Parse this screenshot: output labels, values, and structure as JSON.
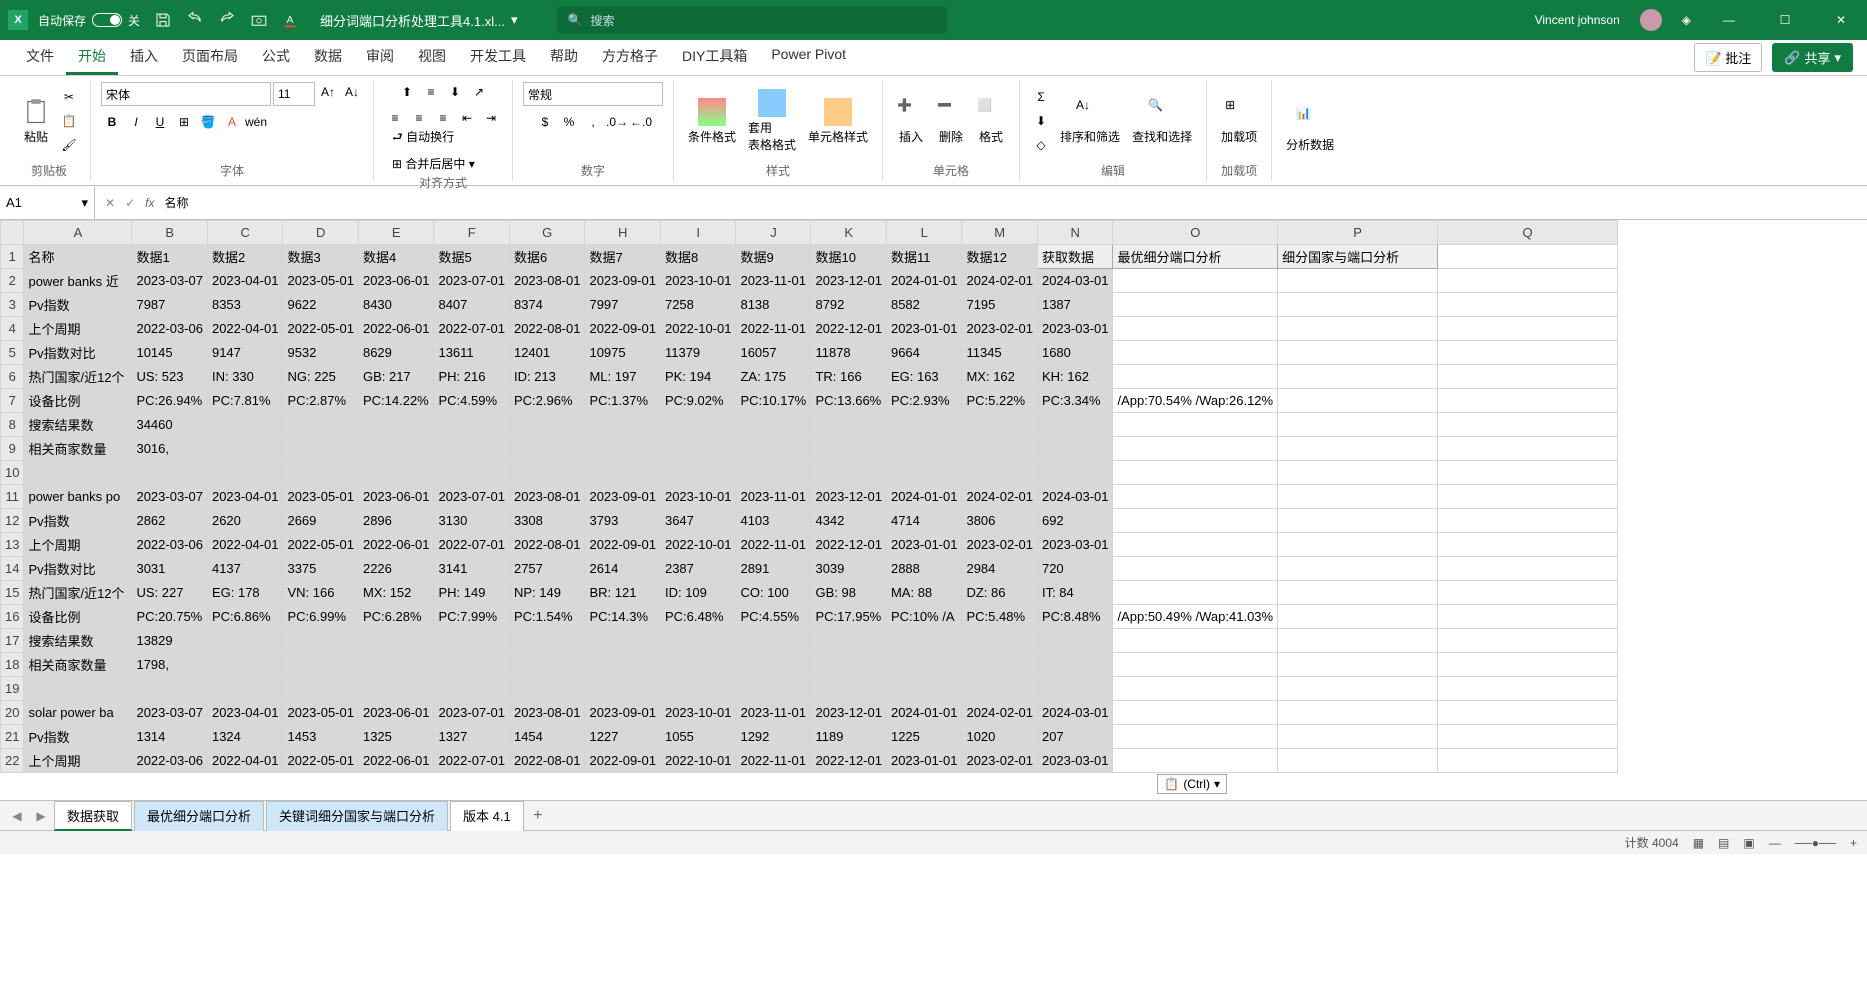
{
  "titlebar": {
    "autosave_label": "自动保存",
    "autosave_state": "关",
    "filename": "细分词端口分析处理工具4.1.xl...",
    "search_placeholder": "搜索",
    "username": "Vincent johnson"
  },
  "ribbon": {
    "tabs": [
      "文件",
      "开始",
      "插入",
      "页面布局",
      "公式",
      "数据",
      "审阅",
      "视图",
      "开发工具",
      "帮助",
      "方方格子",
      "DIY工具箱",
      "Power Pivot"
    ],
    "active_tab": "开始",
    "comment_btn": "批注",
    "share_btn": "共享",
    "groups": {
      "clipboard": {
        "paste": "粘贴",
        "label": "剪贴板"
      },
      "font": {
        "name": "宋体",
        "size": "11",
        "label": "字体"
      },
      "align": {
        "wrap": "自动换行",
        "merge": "合并后居中",
        "label": "对齐方式"
      },
      "number": {
        "format": "常规",
        "label": "数字"
      },
      "styles": {
        "cond": "条件格式",
        "table": "套用\n表格格式",
        "cell": "单元格样式",
        "label": "样式"
      },
      "cells": {
        "insert": "插入",
        "delete": "删除",
        "format": "格式",
        "label": "单元格"
      },
      "editing": {
        "sort": "排序和筛选",
        "find": "查找和选择",
        "label": "编辑"
      },
      "addins": {
        "addin": "加载项",
        "label": "加载项"
      },
      "analysis": {
        "analyze": "分析数据"
      }
    }
  },
  "namebox": "A1",
  "formula": "名称",
  "columns": [
    "A",
    "B",
    "C",
    "D",
    "E",
    "F",
    "G",
    "H",
    "I",
    "J",
    "K",
    "L",
    "M",
    "N",
    "O",
    "P",
    "Q"
  ],
  "rows": {
    "1": [
      "名称",
      "数据1",
      "数据2",
      "数据3",
      "数据4",
      "数据5",
      "数据6",
      "数据7",
      "数据8",
      "数据9",
      "数据10",
      "数据11",
      "数据12",
      "获取数据",
      "最优细分端口分析",
      "细分国家与端口分析",
      ""
    ],
    "2": [
      "power banks 近",
      "2023-03-07",
      "2023-04-01",
      "2023-05-01",
      "2023-06-01",
      "2023-07-01",
      "2023-08-01",
      "2023-09-01",
      "2023-10-01",
      "2023-11-01",
      "2023-12-01",
      "2024-01-01",
      "2024-02-01",
      "2024-03-01",
      "",
      "",
      ""
    ],
    "3": [
      "Pv指数",
      "7987",
      "8353",
      "9622",
      "8430",
      "8407",
      "8374",
      "7997",
      "7258",
      "8138",
      "8792",
      "8582",
      "7195",
      "1387",
      "",
      "",
      ""
    ],
    "4": [
      "上个周期",
      "2022-03-06",
      "2022-04-01",
      "2022-05-01",
      "2022-06-01",
      "2022-07-01",
      "2022-08-01",
      "2022-09-01",
      "2022-10-01",
      "2022-11-01",
      "2022-12-01",
      "2023-01-01",
      "2023-02-01",
      "2023-03-01",
      "",
      "",
      ""
    ],
    "5": [
      "Pv指数对比",
      "10145",
      "9147",
      "9532",
      "8629",
      "13611",
      "12401",
      "10975",
      "11379",
      "16057",
      "11878",
      "9664",
      "11345",
      "1680",
      "",
      "",
      ""
    ],
    "6": [
      "热门国家/近12个",
      "US: 523",
      "IN: 330",
      "NG: 225",
      "GB: 217",
      "PH: 216",
      "ID: 213",
      "ML: 197",
      "PK: 194",
      "ZA: 175",
      "TR: 166",
      "EG: 163",
      "MX: 162",
      "KH: 162",
      "",
      "",
      ""
    ],
    "7": [
      "设备比例",
      "PC:26.94%",
      "PC:7.81%",
      "PC:2.87%",
      "PC:14.22%",
      "PC:4.59%",
      "PC:2.96%",
      "PC:1.37%",
      "PC:9.02%",
      "PC:10.17%",
      "PC:13.66%",
      "PC:2.93%",
      "PC:5.22%",
      "PC:3.34%",
      "/App:70.54% /Wap:26.12%",
      "",
      ""
    ],
    "8": [
      "搜索结果数",
      "34460",
      "",
      "",
      "",
      "",
      "",
      "",
      "",
      "",
      "",
      "",
      "",
      "",
      "",
      "",
      ""
    ],
    "9": [
      "相关商家数量",
      "3016,",
      "",
      "",
      "",
      "",
      "",
      "",
      "",
      "",
      "",
      "",
      "",
      "",
      "",
      "",
      ""
    ],
    "10": [
      "",
      "",
      "",
      "",
      "",
      "",
      "",
      "",
      "",
      "",
      "",
      "",
      "",
      "",
      "",
      "",
      ""
    ],
    "11": [
      "power banks po",
      "2023-03-07",
      "2023-04-01",
      "2023-05-01",
      "2023-06-01",
      "2023-07-01",
      "2023-08-01",
      "2023-09-01",
      "2023-10-01",
      "2023-11-01",
      "2023-12-01",
      "2024-01-01",
      "2024-02-01",
      "2024-03-01",
      "",
      "",
      ""
    ],
    "12": [
      "Pv指数",
      "2862",
      "2620",
      "2669",
      "2896",
      "3130",
      "3308",
      "3793",
      "3647",
      "4103",
      "4342",
      "4714",
      "3806",
      "692",
      "",
      "",
      ""
    ],
    "13": [
      "上个周期",
      "2022-03-06",
      "2022-04-01",
      "2022-05-01",
      "2022-06-01",
      "2022-07-01",
      "2022-08-01",
      "2022-09-01",
      "2022-10-01",
      "2022-11-01",
      "2022-12-01",
      "2023-01-01",
      "2023-02-01",
      "2023-03-01",
      "",
      "",
      ""
    ],
    "14": [
      "Pv指数对比",
      "3031",
      "4137",
      "3375",
      "2226",
      "3141",
      "2757",
      "2614",
      "2387",
      "2891",
      "3039",
      "2888",
      "2984",
      "720",
      "",
      "",
      ""
    ],
    "15": [
      "热门国家/近12个",
      "US: 227",
      "EG: 178",
      "VN: 166",
      "MX: 152",
      "PH: 149",
      "NP: 149",
      "BR: 121",
      "ID: 109",
      "CO: 100",
      "GB: 98",
      "MA: 88",
      "DZ: 86",
      "IT: 84",
      "",
      "",
      ""
    ],
    "16": [
      "设备比例",
      "PC:20.75%",
      "PC:6.86%",
      "PC:6.99%",
      "PC:6.28%",
      "PC:7.99%",
      "PC:1.54%",
      "PC:14.3%",
      "PC:6.48%",
      "PC:4.55%",
      "PC:17.95%",
      "PC:10% /A",
      "PC:5.48%",
      "PC:8.48%",
      "/App:50.49% /Wap:41.03%",
      "",
      ""
    ],
    "17": [
      "搜索结果数",
      "13829",
      "",
      "",
      "",
      "",
      "",
      "",
      "",
      "",
      "",
      "",
      "",
      "",
      "",
      "",
      ""
    ],
    "18": [
      "相关商家数量",
      "1798,",
      "",
      "",
      "",
      "",
      "",
      "",
      "",
      "",
      "",
      "",
      "",
      "",
      "",
      "",
      ""
    ],
    "19": [
      "",
      "",
      "",
      "",
      "",
      "",
      "",
      "",
      "",
      "",
      "",
      "",
      "",
      "",
      "",
      "",
      ""
    ],
    "20": [
      "solar power ba",
      "2023-03-07",
      "2023-04-01",
      "2023-05-01",
      "2023-06-01",
      "2023-07-01",
      "2023-08-01",
      "2023-09-01",
      "2023-10-01",
      "2023-11-01",
      "2023-12-01",
      "2024-01-01",
      "2024-02-01",
      "2024-03-01",
      "",
      "",
      ""
    ],
    "21": [
      "Pv指数",
      "1314",
      "1324",
      "1453",
      "1325",
      "1327",
      "1454",
      "1227",
      "1055",
      "1292",
      "1189",
      "1225",
      "1020",
      "207",
      "",
      "",
      ""
    ],
    "22": [
      "上个周期",
      "2022-03-06",
      "2022-04-01",
      "2022-05-01",
      "2022-06-01",
      "2022-07-01",
      "2022-08-01",
      "2022-09-01",
      "2022-10-01",
      "2022-11-01",
      "2022-12-01",
      "2023-01-01",
      "2023-02-01",
      "2023-03-01",
      "",
      "",
      ""
    ]
  },
  "paste_indicator": "(Ctrl)",
  "sheets": {
    "tabs": [
      "数据获取",
      "最优细分端口分析",
      "关键词细分国家与端口分析",
      "版本 4.1"
    ],
    "active": "数据获取"
  },
  "statusbar": {
    "count": "计数 4004"
  }
}
